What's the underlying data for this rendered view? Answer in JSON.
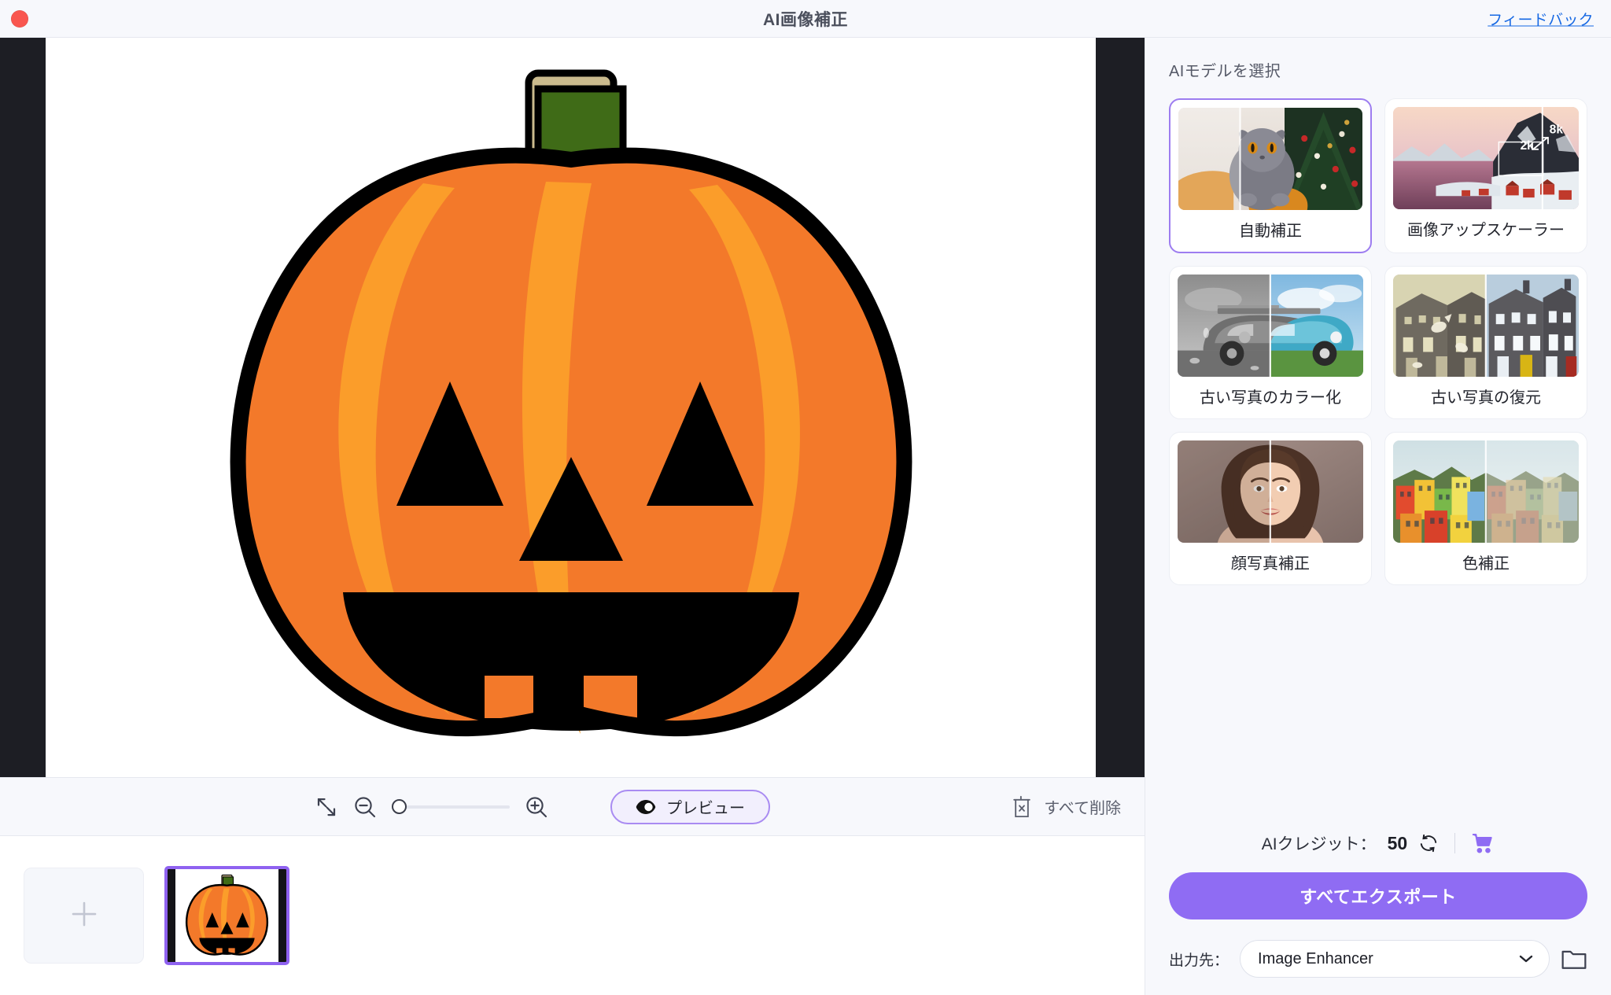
{
  "window": {
    "title": "AI画像補正",
    "feedback_link": "フィードバック",
    "close_button": "close"
  },
  "toolbar": {
    "fit_icon": "fit-to-screen-icon",
    "zoom_out_icon": "zoom-out-icon",
    "zoom_in_icon": "zoom-in-icon",
    "zoom_slider_value": 0,
    "preview_label": "プレビュー",
    "preview_icon": "eye-icon",
    "delete_all_label": "すべて削除",
    "delete_all_icon": "trash-x-icon"
  },
  "thumbnails": {
    "add_label": "+",
    "add_icon": "plus-icon",
    "items": [
      {
        "name": "pumpkin",
        "selected": true
      }
    ]
  },
  "panel": {
    "heading": "AIモデルを選択",
    "models": [
      {
        "label": "自動補正",
        "selected": true,
        "art": "cat"
      },
      {
        "label": "画像アップスケーラー",
        "selected": false,
        "art": "upscaler",
        "badge_low": "2k",
        "badge_high": "8k"
      },
      {
        "label": "古い写真のカラー化",
        "selected": false,
        "art": "car"
      },
      {
        "label": "古い写真の復元",
        "selected": false,
        "art": "houses"
      },
      {
        "label": "顔写真補正",
        "selected": false,
        "art": "portrait"
      },
      {
        "label": "色補正",
        "selected": false,
        "art": "village"
      }
    ]
  },
  "credits": {
    "label": "AIクレジット：",
    "value": "50",
    "refresh_icon": "refresh-icon",
    "cart_icon": "cart-icon"
  },
  "export": {
    "button_label": "すべてエクスポート"
  },
  "output": {
    "label": "出力先：",
    "value": "Image Enhancer",
    "chevron_icon": "chevron-down-icon",
    "folder_icon": "folder-icon"
  },
  "colors": {
    "accent_purple": "#8f6cf3",
    "selected_border": "#9d7df0",
    "link_blue": "#1668e3",
    "close_red": "#f9564f",
    "letterbox": "#1d1e24"
  }
}
